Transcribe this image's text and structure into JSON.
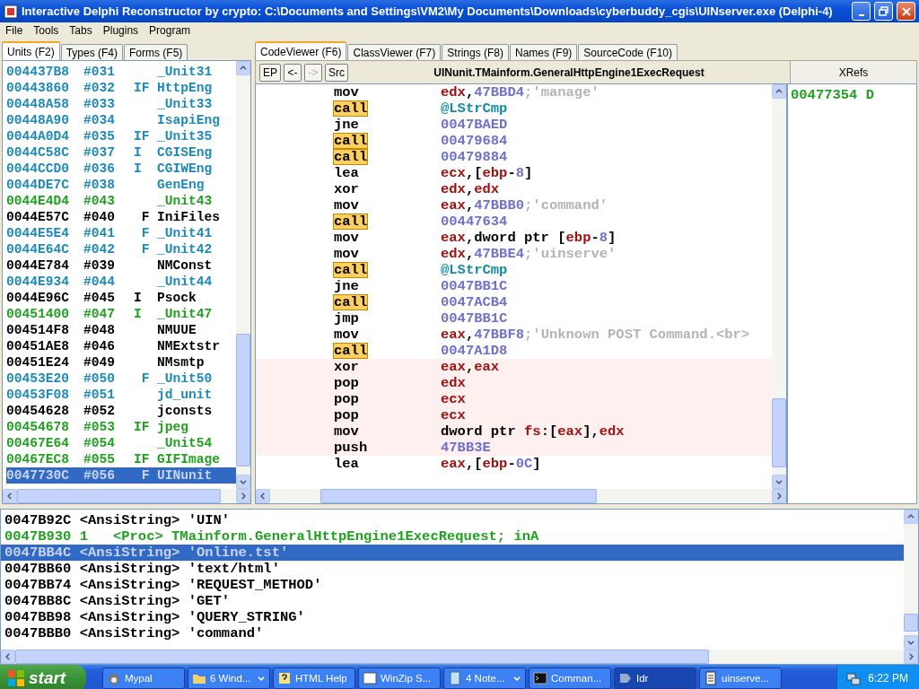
{
  "window": {
    "title": "Interactive Delphi Reconstructor by crypto: C:\\Documents and Settings\\VM2\\My Documents\\Downloads\\cyberbuddy_cgis\\UINserver.exe (Delphi-4)"
  },
  "menu": [
    "File",
    "Tools",
    "Tabs",
    "Plugins",
    "Program"
  ],
  "left_tabs": [
    {
      "label": "Units (F2)",
      "selected": true
    },
    {
      "label": "Types (F4)",
      "selected": false
    },
    {
      "label": "Forms (F5)",
      "selected": false
    }
  ],
  "units": [
    {
      "address": "004437B8",
      "number": "#031",
      "name": "_Unit31",
      "color": "#1f8ab5",
      "selected": false
    },
    {
      "address": "00443860",
      "number": "#032",
      "flags": "IF",
      "name": "HttpEng",
      "color": "#1f8ab5",
      "selected": false
    },
    {
      "address": "00448A58",
      "number": "#033",
      "name": "_Unit33",
      "color": "#1f8ab5",
      "selected": false
    },
    {
      "address": "00448A90",
      "number": "#034",
      "name": "IsapiEng",
      "color": "#1f8ab5",
      "selected": false
    },
    {
      "address": "0044A0D4",
      "number": "#035",
      "flags": "IF",
      "name": "_Unit35",
      "color": "#1f8ab5",
      "selected": false
    },
    {
      "address": "0044C58C",
      "number": "#037",
      "flags": "I",
      "name": "CGISEng",
      "color": "#1f8ab5",
      "selected": false
    },
    {
      "address": "0044CCD0",
      "number": "#036",
      "flags": "I",
      "name": "CGIWEng",
      "color": "#1f8ab5",
      "selected": false
    },
    {
      "address": "0044DE7C",
      "number": "#038",
      "name": "GenEng",
      "color": "#1f8ab5",
      "selected": false
    },
    {
      "address": "0044E4D4",
      "number": "#043",
      "name": "_Unit43",
      "color": "#22a022",
      "selected": false
    },
    {
      "address": "0044E57C",
      "number": "#040",
      "flags": " F",
      "name": "IniFiles",
      "color": "#000000",
      "selected": false
    },
    {
      "address": "0044E5E4",
      "number": "#041",
      "flags": " F",
      "name": "_Unit41",
      "color": "#1f8ab5",
      "selected": false
    },
    {
      "address": "0044E64C",
      "number": "#042",
      "flags": " F",
      "name": "_Unit42",
      "color": "#1f8ab5",
      "selected": false
    },
    {
      "address": "0044E784",
      "number": "#039",
      "name": "NMConst",
      "color": "#000000",
      "selected": false
    },
    {
      "address": "0044E934",
      "number": "#044",
      "name": "_Unit44",
      "color": "#1f8ab5",
      "selected": false
    },
    {
      "address": "0044E96C",
      "number": "#045",
      "flags": "I",
      "name": "Psock",
      "color": "#000000",
      "selected": false
    },
    {
      "address": "00451400",
      "number": "#047",
      "flags": "I",
      "name": "_Unit47",
      "color": "#22a022",
      "selected": false
    },
    {
      "address": "004514F8",
      "number": "#048",
      "name": "NMUUE",
      "color": "#000000",
      "selected": false
    },
    {
      "address": "00451AE8",
      "number": "#046",
      "name": "NMExtstr",
      "color": "#000000",
      "selected": false
    },
    {
      "address": "00451E24",
      "number": "#049",
      "name": "NMsmtp",
      "color": "#000000",
      "selected": false
    },
    {
      "address": "00453E20",
      "number": "#050",
      "flags": " F",
      "name": "_Unit50",
      "color": "#1f8ab5",
      "selected": false
    },
    {
      "address": "00453F08",
      "number": "#051",
      "name": "jd_unit",
      "color": "#1f8ab5",
      "selected": false
    },
    {
      "address": "00454628",
      "number": "#052",
      "name": "jconsts",
      "color": "#000000",
      "selected": false
    },
    {
      "address": "00454678",
      "number": "#053",
      "flags": "IF",
      "name": "jpeg",
      "color": "#22a022",
      "selected": false
    },
    {
      "address": "00467E64",
      "number": "#054",
      "name": "_Unit54",
      "color": "#22a022",
      "selected": false
    },
    {
      "address": "00467EC8",
      "number": "#055",
      "flags": "IF",
      "name": "GIFImage",
      "color": "#22a022",
      "selected": false
    },
    {
      "address": "0047730C",
      "number": "#056",
      "flags": " F",
      "name": "UINunit",
      "selected": true
    }
  ],
  "code_tabs": [
    {
      "label": "CodeViewer (F6)",
      "selected": true
    },
    {
      "label": "ClassViewer (F7)",
      "selected": false
    },
    {
      "label": "Strings (F8)",
      "selected": false
    },
    {
      "label": "Names (F9)",
      "selected": false
    },
    {
      "label": "SourceCode (F10)",
      "selected": false
    }
  ],
  "code_toolbar": {
    "buttons": [
      {
        "label": "EP",
        "disabled": false
      },
      {
        "label": "<-",
        "disabled": false
      },
      {
        "label": "->",
        "disabled": true
      },
      {
        "label": "Src",
        "disabled": false
      }
    ],
    "title": "UINunit.TMainform.GeneralHttpEngine1ExecRequest"
  },
  "code": [
    {
      "mnemonic": "mov",
      "highlighted": false,
      "marked": false,
      "operand": [
        {
          "kind": "reg",
          "text": "edx"
        },
        {
          "kind": "plain",
          "text": ","
        },
        {
          "kind": "num",
          "text": "47BBD4"
        },
        {
          "kind": "comment",
          "text": ";'manage'"
        }
      ]
    },
    {
      "mnemonic": "call",
      "highlighted": true,
      "marked": false,
      "operand": [
        {
          "kind": "sym",
          "text": "@LStrCmp"
        }
      ]
    },
    {
      "mnemonic": "jne",
      "highlighted": false,
      "marked": false,
      "operand": [
        {
          "kind": "num",
          "text": "0047BAED"
        }
      ]
    },
    {
      "mnemonic": "call",
      "highlighted": true,
      "marked": false,
      "operand": [
        {
          "kind": "num",
          "text": "00479684"
        }
      ]
    },
    {
      "mnemonic": "call",
      "highlighted": true,
      "marked": false,
      "operand": [
        {
          "kind": "num",
          "text": "00479884"
        }
      ]
    },
    {
      "mnemonic": "lea",
      "highlighted": false,
      "marked": false,
      "operand": [
        {
          "kind": "reg",
          "text": "ecx"
        },
        {
          "kind": "plain",
          "text": ",["
        },
        {
          "kind": "reg",
          "text": "ebp"
        },
        {
          "kind": "plain",
          "text": "-"
        },
        {
          "kind": "num",
          "text": "8"
        },
        {
          "kind": "plain",
          "text": "]"
        }
      ]
    },
    {
      "mnemonic": "xor",
      "highlighted": false,
      "marked": false,
      "operand": [
        {
          "kind": "reg",
          "text": "edx"
        },
        {
          "kind": "plain",
          "text": ","
        },
        {
          "kind": "reg",
          "text": "edx"
        }
      ]
    },
    {
      "mnemonic": "mov",
      "highlighted": false,
      "marked": false,
      "operand": [
        {
          "kind": "reg",
          "text": "eax"
        },
        {
          "kind": "plain",
          "text": ","
        },
        {
          "kind": "num",
          "text": "47BBB0"
        },
        {
          "kind": "comment",
          "text": ";'command'"
        }
      ]
    },
    {
      "mnemonic": "call",
      "highlighted": true,
      "marked": false,
      "operand": [
        {
          "kind": "num",
          "text": "00447634"
        }
      ]
    },
    {
      "mnemonic": "mov",
      "highlighted": false,
      "marked": false,
      "operand": [
        {
          "kind": "reg",
          "text": "eax"
        },
        {
          "kind": "plain",
          "text": ",dword ptr ["
        },
        {
          "kind": "reg",
          "text": "ebp"
        },
        {
          "kind": "plain",
          "text": "-"
        },
        {
          "kind": "num",
          "text": "8"
        },
        {
          "kind": "plain",
          "text": "]"
        }
      ]
    },
    {
      "mnemonic": "mov",
      "highlighted": false,
      "marked": false,
      "operand": [
        {
          "kind": "reg",
          "text": "edx"
        },
        {
          "kind": "plain",
          "text": ","
        },
        {
          "kind": "num",
          "text": "47BBE4"
        },
        {
          "kind": "comment",
          "text": ";'uinserve'"
        }
      ]
    },
    {
      "mnemonic": "call",
      "highlighted": true,
      "marked": false,
      "operand": [
        {
          "kind": "sym",
          "text": "@LStrCmp"
        }
      ]
    },
    {
      "mnemonic": "jne",
      "highlighted": false,
      "marked": false,
      "operand": [
        {
          "kind": "num",
          "text": "0047BB1C"
        }
      ]
    },
    {
      "mnemonic": "call",
      "highlighted": true,
      "marked": false,
      "operand": [
        {
          "kind": "num",
          "text": "0047ACB4"
        }
      ]
    },
    {
      "mnemonic": "jmp",
      "highlighted": false,
      "marked": false,
      "operand": [
        {
          "kind": "num",
          "text": "0047BB1C"
        }
      ]
    },
    {
      "mnemonic": "mov",
      "highlighted": false,
      "marked": false,
      "operand": [
        {
          "kind": "reg",
          "text": "eax"
        },
        {
          "kind": "plain",
          "text": ","
        },
        {
          "kind": "num",
          "text": "47BBF8"
        },
        {
          "kind": "comment",
          "text": ";'Unknown POST Command.<br>"
        }
      ]
    },
    {
      "mnemonic": "call",
      "highlighted": true,
      "marked": false,
      "operand": [
        {
          "kind": "num",
          "text": "0047A1D8"
        }
      ]
    },
    {
      "mnemonic": "xor",
      "highlighted": false,
      "marked": true,
      "operand": [
        {
          "kind": "reg",
          "text": "eax"
        },
        {
          "kind": "plain",
          "text": ","
        },
        {
          "kind": "reg",
          "text": "eax"
        }
      ]
    },
    {
      "mnemonic": "pop",
      "highlighted": false,
      "marked": true,
      "operand": [
        {
          "kind": "reg",
          "text": "edx"
        }
      ]
    },
    {
      "mnemonic": "pop",
      "highlighted": false,
      "marked": true,
      "operand": [
        {
          "kind": "reg",
          "text": "ecx"
        }
      ]
    },
    {
      "mnemonic": "pop",
      "highlighted": false,
      "marked": true,
      "operand": [
        {
          "kind": "reg",
          "text": "ecx"
        }
      ]
    },
    {
      "mnemonic": "mov",
      "highlighted": false,
      "marked": true,
      "operand": [
        {
          "kind": "plain",
          "text": "dword ptr "
        },
        {
          "kind": "reg",
          "text": "fs"
        },
        {
          "kind": "plain",
          "text": ":["
        },
        {
          "kind": "reg",
          "text": "eax"
        },
        {
          "kind": "plain",
          "text": "],"
        },
        {
          "kind": "reg",
          "text": "edx"
        }
      ]
    },
    {
      "mnemonic": "push",
      "highlighted": false,
      "marked": true,
      "operand": [
        {
          "kind": "num",
          "text": "47BB3E"
        }
      ]
    },
    {
      "mnemonic": "lea",
      "highlighted": false,
      "marked": false,
      "operand": [
        {
          "kind": "reg",
          "text": "eax"
        },
        {
          "kind": "plain",
          "text": ",["
        },
        {
          "kind": "reg",
          "text": "ebp"
        },
        {
          "kind": "plain",
          "text": "-"
        },
        {
          "kind": "num",
          "text": "0C"
        },
        {
          "kind": "plain",
          "text": "]"
        }
      ]
    }
  ],
  "xrefs": {
    "header": "XRefs",
    "items": [
      "00477354 D"
    ]
  },
  "strings": [
    {
      "text": "0047B92C <AnsiString> 'UIN'",
      "color": "#000000",
      "selected": false
    },
    {
      "text": "0047B930 1   <Proc> TMainform.GeneralHttpEngine1ExecRequest; inA",
      "color": "#22a022",
      "selected": false
    },
    {
      "text": "0047BB4C <AnsiString> 'Online.tst'",
      "selected": true
    },
    {
      "text": "0047BB60 <AnsiString> 'text/html'",
      "color": "#000000",
      "selected": false
    },
    {
      "text": "0047BB74 <AnsiString> 'REQUEST_METHOD'",
      "color": "#000000",
      "selected": false
    },
    {
      "text": "0047BB8C <AnsiString> 'GET'",
      "color": "#000000",
      "selected": false
    },
    {
      "text": "0047BB98 <AnsiString> 'QUERY_STRING'",
      "color": "#000000",
      "selected": false
    },
    {
      "text": "0047BBB0 <AnsiString> 'command'",
      "color": "#000000",
      "selected": false
    }
  ],
  "taskbar": {
    "start": "start",
    "items": [
      {
        "label": "Mypal",
        "grouped": false,
        "selected": false
      },
      {
        "label": "6 Wind...",
        "grouped": true,
        "selected": false
      },
      {
        "label": "HTML Help",
        "grouped": false,
        "selected": false
      },
      {
        "label": "WinZip S...",
        "grouped": false,
        "selected": false
      },
      {
        "label": "4 Note...",
        "grouped": true,
        "selected": false
      },
      {
        "label": "Comman...",
        "grouped": false,
        "selected": false
      },
      {
        "label": "Idr",
        "grouped": false,
        "selected": true
      },
      {
        "label": "uinserve...",
        "grouped": false,
        "selected": false
      }
    ],
    "clock": "6:22 PM"
  }
}
